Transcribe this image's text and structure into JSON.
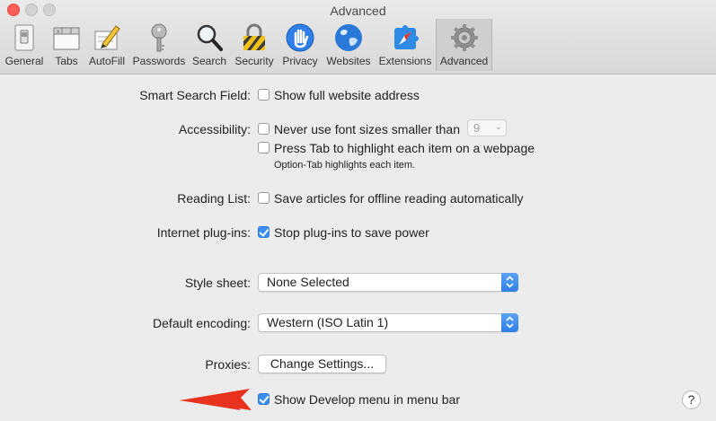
{
  "window": {
    "title": "Advanced"
  },
  "toolbar": {
    "items": [
      {
        "label": "General",
        "icon": "general-switch-icon"
      },
      {
        "label": "Tabs",
        "icon": "tabs-icon"
      },
      {
        "label": "AutoFill",
        "icon": "pencil-form-icon"
      },
      {
        "label": "Passwords",
        "icon": "key-icon"
      },
      {
        "label": "Search",
        "icon": "magnifier-icon"
      },
      {
        "label": "Security",
        "icon": "padlock-icon"
      },
      {
        "label": "Privacy",
        "icon": "hand-icon"
      },
      {
        "label": "Websites",
        "icon": "globe-icon"
      },
      {
        "label": "Extensions",
        "icon": "puzzle-compass-icon"
      },
      {
        "label": "Advanced",
        "icon": "gear-icon",
        "selected": true
      }
    ]
  },
  "settings": {
    "smart_search": {
      "label": "Smart Search Field:",
      "option": "Show full website address",
      "checked": false
    },
    "accessibility": {
      "label": "Accessibility:",
      "font_option": "Never use font sizes smaller than",
      "font_value": "9",
      "tab_option": "Press Tab to highlight each item on a webpage",
      "tab_note": "Option-Tab highlights each item.",
      "font_checked": false,
      "tab_checked": false
    },
    "reading_list": {
      "label": "Reading List:",
      "option": "Save articles for offline reading automatically",
      "checked": false
    },
    "plugins": {
      "label": "Internet plug-ins:",
      "option": "Stop plug-ins to save power",
      "checked": true
    },
    "style_sheet": {
      "label": "Style sheet:",
      "value": "None Selected"
    },
    "encoding": {
      "label": "Default encoding:",
      "value": "Western (ISO Latin 1)"
    },
    "proxies": {
      "label": "Proxies:",
      "button": "Change Settings..."
    },
    "develop": {
      "option": "Show Develop menu in menu bar",
      "checked": true
    }
  },
  "help": {
    "glyph": "?"
  },
  "colors": {
    "accent": "#3b8ef1",
    "arrow": "#e8321f",
    "close": "#ff5f57"
  }
}
